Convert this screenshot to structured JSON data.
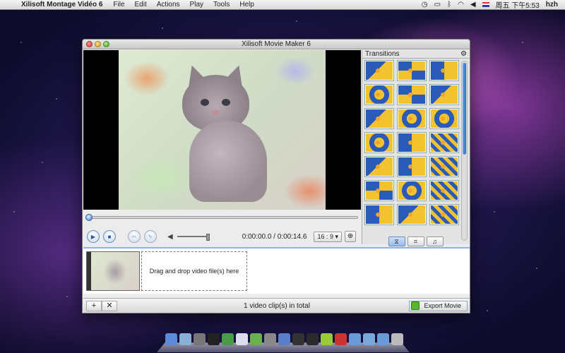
{
  "menubar": {
    "app_name": "Xilisoft Montage Vidéo 6",
    "menus": [
      "File",
      "Edit",
      "Actions",
      "Play",
      "Tools",
      "Help"
    ],
    "clock": "周五 下午5:53",
    "user": "hzh"
  },
  "window": {
    "title": "Xilisoft Movie Maker 6"
  },
  "player": {
    "time": "0:00:00.0 / 0:00:14.6",
    "aspect_ratio": "16 : 9",
    "progress_fraction": 0
  },
  "transitions_panel": {
    "title": "Transitions",
    "thumb_count": 21
  },
  "timeline": {
    "drop_hint": "Drag and drop video file(s) here"
  },
  "statusbar": {
    "add_label": "+",
    "remove_label": "✕",
    "total_text": "1 video clip(s) in total",
    "export_label": "Export Movie"
  },
  "colors": {
    "accent": "#2d6ccf",
    "export_green": "#58b52e"
  }
}
